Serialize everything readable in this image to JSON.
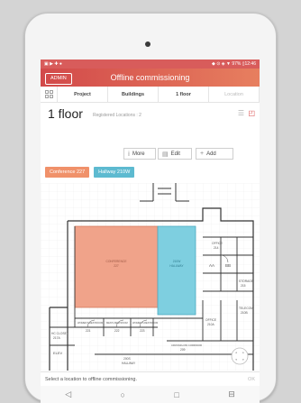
{
  "status_bar": {
    "left": "▣ ▶ ✚ ●",
    "right": "◆ ⊙ ◈ ▼ 97% ▯12:46"
  },
  "app_bar": {
    "admin_label": "ADMIN",
    "title": "Offline commissioning"
  },
  "breadcrumb": {
    "home_icon": "grid-icon",
    "items": [
      {
        "label": "Project"
      },
      {
        "label": "Buildings"
      },
      {
        "label": "1 floor"
      },
      {
        "label": "Location"
      }
    ]
  },
  "floor": {
    "title": "1 floor",
    "subtitle": "Registered Locations : 2"
  },
  "actions": {
    "more": "More",
    "edit": "Edit",
    "add": "Add"
  },
  "tags": [
    {
      "label": "Conference 227",
      "color": "#f0916a"
    },
    {
      "label": "Hallway 210W",
      "color": "#5dbad0"
    }
  ],
  "plan": {
    "conference_label": "CONFERENCE",
    "conference_num": "227",
    "hallway_label": "HALLWAY",
    "hallway_num": "210W",
    "room_labels": {
      "office": "OFFICE",
      "office_num": "214",
      "aa": "AA",
      "bb": "BB",
      "storage": "STORAGE",
      "storage_num": "215",
      "telecom": "TELECOM",
      "telecom_num": "210B",
      "womens": "WOMEN'S RESTROOM",
      "womens_num": "221",
      "mens": "MEN'S RESTROOM",
      "mens_num": "222",
      "womens2": "WOMEN'S RESTROOM",
      "womens2_num": "223",
      "hc_closet": "HC CLOSET",
      "hc_closet_num": "217A",
      "elev": "ELEV",
      "office2": "OFFICE",
      "office2_num": "210A",
      "corridor": "CROSSFLOW CORRIDOR",
      "corridor_num": "209",
      "hallway2": "HALLWAY",
      "hallway2_num": "200S"
    },
    "colors": {
      "conference": "#f0a38a",
      "hallway": "#7ecfe0",
      "wall": "#333333",
      "grid": "#ececec"
    }
  },
  "hint": {
    "text": "Select a location to offline commissioning.",
    "ok": "OK"
  },
  "nav": {
    "back": "◁",
    "home": "○",
    "recent": "□",
    "extra": "⊟"
  }
}
